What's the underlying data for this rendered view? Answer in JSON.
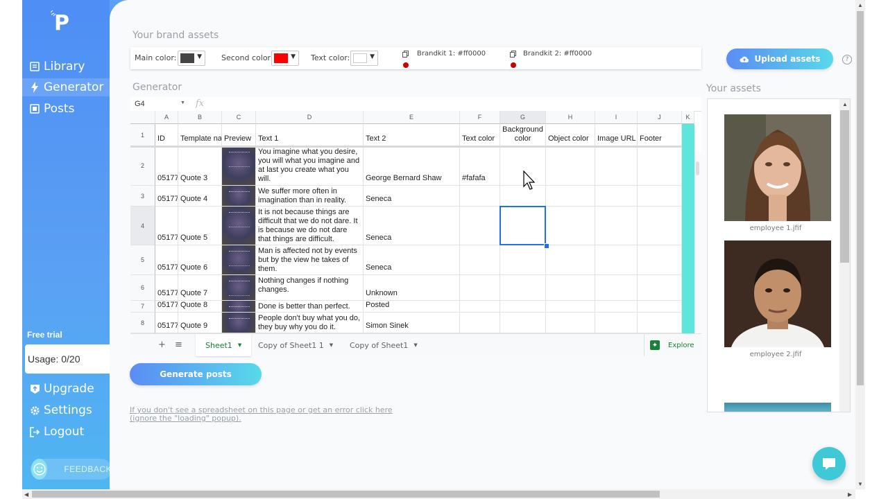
{
  "sidebar": {
    "logo": "P",
    "nav": [
      {
        "label": "Library",
        "icon": "library-icon"
      },
      {
        "label": "Generator",
        "icon": "bolt-icon"
      },
      {
        "label": "Posts",
        "icon": "posts-icon"
      }
    ],
    "free_trial_label": "Free trial",
    "usage": "Usage: 0/20",
    "bottom_nav": [
      {
        "label": "Upgrade",
        "icon": "upgrade-icon"
      },
      {
        "label": "Settings",
        "icon": "gear-icon"
      },
      {
        "label": "Logout",
        "icon": "logout-icon"
      }
    ],
    "feedback_label": "FEEDBACK"
  },
  "brand": {
    "title": "Your brand assets",
    "main_color_label": "Main color:",
    "main_color": "#444444",
    "second_color_label": "Second color:",
    "second_color": "#ff0000",
    "text_color_label": "Text color:",
    "text_color": "#ffffff",
    "brandkit1": "Brandkit 1: #ff0000",
    "brandkit2": "Brandkit 2: #ff0000",
    "upload_label": "Upload assets"
  },
  "generator": {
    "title": "Generator",
    "cell_ref": "G4",
    "fx": "fx",
    "columns": [
      "A",
      "B",
      "C",
      "D",
      "E",
      "F",
      "G",
      "H",
      "I",
      "J",
      "K"
    ],
    "headers": [
      "ID",
      "Template na",
      "Preview",
      "Text 1",
      "Text 2",
      "Text color",
      "Background color",
      "Object color",
      "Image URL",
      "Footer",
      ""
    ],
    "rows": [
      {
        "num": "2",
        "id": "05177",
        "template": "Quote 3",
        "text1": "You imagine what you desire, you will what you imagine and at last you create what you will.",
        "text2": "George Bernard Shaw",
        "text_color": "#fafafa"
      },
      {
        "num": "3",
        "id": "05177",
        "template": "Quote 4",
        "text1": "We suffer more often in imagination than in reality.",
        "text2": "Seneca",
        "text_color": ""
      },
      {
        "num": "4",
        "id": "05177",
        "template": "Quote 5",
        "text1": "It is not because things are difficult that we do not dare. It is because we do not dare that things are difficult.",
        "text2": "Seneca",
        "text_color": ""
      },
      {
        "num": "5",
        "id": "05177",
        "template": "Quote 6",
        "text1": "Man is affected not by events but by the view he takes of them.",
        "text2": "Seneca",
        "text_color": ""
      },
      {
        "num": "6",
        "id": "05177",
        "template": "Quote 7",
        "text1": "Nothing changes if nothing changes.",
        "text2": "Unknown",
        "text_color": ""
      },
      {
        "num": "7",
        "id": "05177",
        "template": "Quote 8",
        "text1": "Done is better than perfect.",
        "text2": "Posted",
        "text_color": ""
      },
      {
        "num": "8",
        "id": "05177",
        "template": "Quote 9",
        "text1": "People don't buy what you do, they buy why you do it.",
        "text2": "Simon Sinek",
        "text_color": ""
      }
    ],
    "header_row_num": "1",
    "tabs": [
      "Sheet1",
      "Copy of Sheet1 1",
      "Copy of Sheet1"
    ],
    "explore_label": "Explore",
    "generate_label": "Generate posts",
    "help_link": "If you don't see a spreadsheet on this page or get an error click here (ignore the \"loading\" popup)."
  },
  "assets": {
    "title": "Your assets",
    "items": [
      {
        "name": "employee 1.jfif"
      },
      {
        "name": "employee 2.jfif"
      }
    ]
  }
}
